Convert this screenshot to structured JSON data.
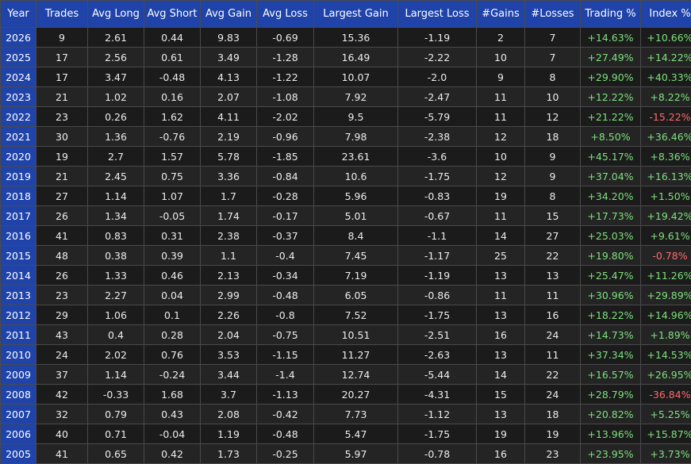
{
  "colors": {
    "header_bg": "#1f43a8",
    "positive": "#7ee07e",
    "negative": "#ff6b6b"
  },
  "columns": [
    "Year",
    "Trades",
    "Avg Long",
    "Avg Short",
    "Avg Gain",
    "Avg Loss",
    "Largest Gain",
    "Largest Loss",
    "#Gains",
    "#Losses",
    "Trading %",
    "Index %"
  ],
  "rows": [
    [
      "2026",
      "9",
      "2.61",
      "0.44",
      "9.83",
      "-0.69",
      "15.36",
      "-1.19",
      "2",
      "7",
      "+14.63%",
      "+10.66%"
    ],
    [
      "2025",
      "17",
      "2.56",
      "0.61",
      "3.49",
      "-1.28",
      "16.49",
      "-2.22",
      "10",
      "7",
      "+27.49%",
      "+14.22%"
    ],
    [
      "2024",
      "17",
      "3.47",
      "-0.48",
      "4.13",
      "-1.22",
      "10.07",
      "-2.0",
      "9",
      "8",
      "+29.90%",
      "+40.33%"
    ],
    [
      "2023",
      "21",
      "1.02",
      "0.16",
      "2.07",
      "-1.08",
      "7.92",
      "-2.47",
      "11",
      "10",
      "+12.22%",
      "+8.22%"
    ],
    [
      "2022",
      "23",
      "0.26",
      "1.62",
      "4.11",
      "-2.02",
      "9.5",
      "-5.79",
      "11",
      "12",
      "+21.22%",
      "-15.22%"
    ],
    [
      "2021",
      "30",
      "1.36",
      "-0.76",
      "2.19",
      "-0.96",
      "7.98",
      "-2.38",
      "12",
      "18",
      "+8.50%",
      "+36.46%"
    ],
    [
      "2020",
      "19",
      "2.7",
      "1.57",
      "5.78",
      "-1.85",
      "23.61",
      "-3.6",
      "10",
      "9",
      "+45.17%",
      "+8.36%"
    ],
    [
      "2019",
      "21",
      "2.45",
      "0.75",
      "3.36",
      "-0.84",
      "10.6",
      "-1.75",
      "12",
      "9",
      "+37.04%",
      "+16.13%"
    ],
    [
      "2018",
      "27",
      "1.14",
      "1.07",
      "1.7",
      "-0.28",
      "5.96",
      "-0.83",
      "19",
      "8",
      "+34.20%",
      "+1.50%"
    ],
    [
      "2017",
      "26",
      "1.34",
      "-0.05",
      "1.74",
      "-0.17",
      "5.01",
      "-0.67",
      "11",
      "15",
      "+17.73%",
      "+19.42%"
    ],
    [
      "2016",
      "41",
      "0.83",
      "0.31",
      "2.38",
      "-0.37",
      "8.4",
      "-1.1",
      "14",
      "27",
      "+25.03%",
      "+9.61%"
    ],
    [
      "2015",
      "48",
      "0.38",
      "0.39",
      "1.1",
      "-0.4",
      "7.45",
      "-1.17",
      "25",
      "22",
      "+19.80%",
      "-0.78%"
    ],
    [
      "2014",
      "26",
      "1.33",
      "0.46",
      "2.13",
      "-0.34",
      "7.19",
      "-1.19",
      "13",
      "13",
      "+25.47%",
      "+11.26%"
    ],
    [
      "2013",
      "23",
      "2.27",
      "0.04",
      "2.99",
      "-0.48",
      "6.05",
      "-0.86",
      "11",
      "11",
      "+30.96%",
      "+29.89%"
    ],
    [
      "2012",
      "29",
      "1.06",
      "0.1",
      "2.26",
      "-0.8",
      "7.52",
      "-1.75",
      "13",
      "16",
      "+18.22%",
      "+14.96%"
    ],
    [
      "2011",
      "43",
      "0.4",
      "0.28",
      "2.04",
      "-0.75",
      "10.51",
      "-2.51",
      "16",
      "24",
      "+14.73%",
      "+1.89%"
    ],
    [
      "2010",
      "24",
      "2.02",
      "0.76",
      "3.53",
      "-1.15",
      "11.27",
      "-2.63",
      "13",
      "11",
      "+37.34%",
      "+14.53%"
    ],
    [
      "2009",
      "37",
      "1.14",
      "-0.24",
      "3.44",
      "-1.4",
      "12.74",
      "-5.44",
      "14",
      "22",
      "+16.57%",
      "+26.95%"
    ],
    [
      "2008",
      "42",
      "-0.33",
      "1.68",
      "3.7",
      "-1.13",
      "20.27",
      "-4.31",
      "15",
      "24",
      "+28.79%",
      "-36.84%"
    ],
    [
      "2007",
      "32",
      "0.79",
      "0.43",
      "2.08",
      "-0.42",
      "7.73",
      "-1.12",
      "13",
      "18",
      "+20.82%",
      "+5.25%"
    ],
    [
      "2006",
      "40",
      "0.71",
      "-0.04",
      "1.19",
      "-0.48",
      "5.47",
      "-1.75",
      "19",
      "19",
      "+13.96%",
      "+15.87%"
    ],
    [
      "2005",
      "41",
      "0.65",
      "0.42",
      "1.73",
      "-0.25",
      "5.97",
      "-0.78",
      "16",
      "23",
      "+23.95%",
      "+3.73%"
    ]
  ]
}
